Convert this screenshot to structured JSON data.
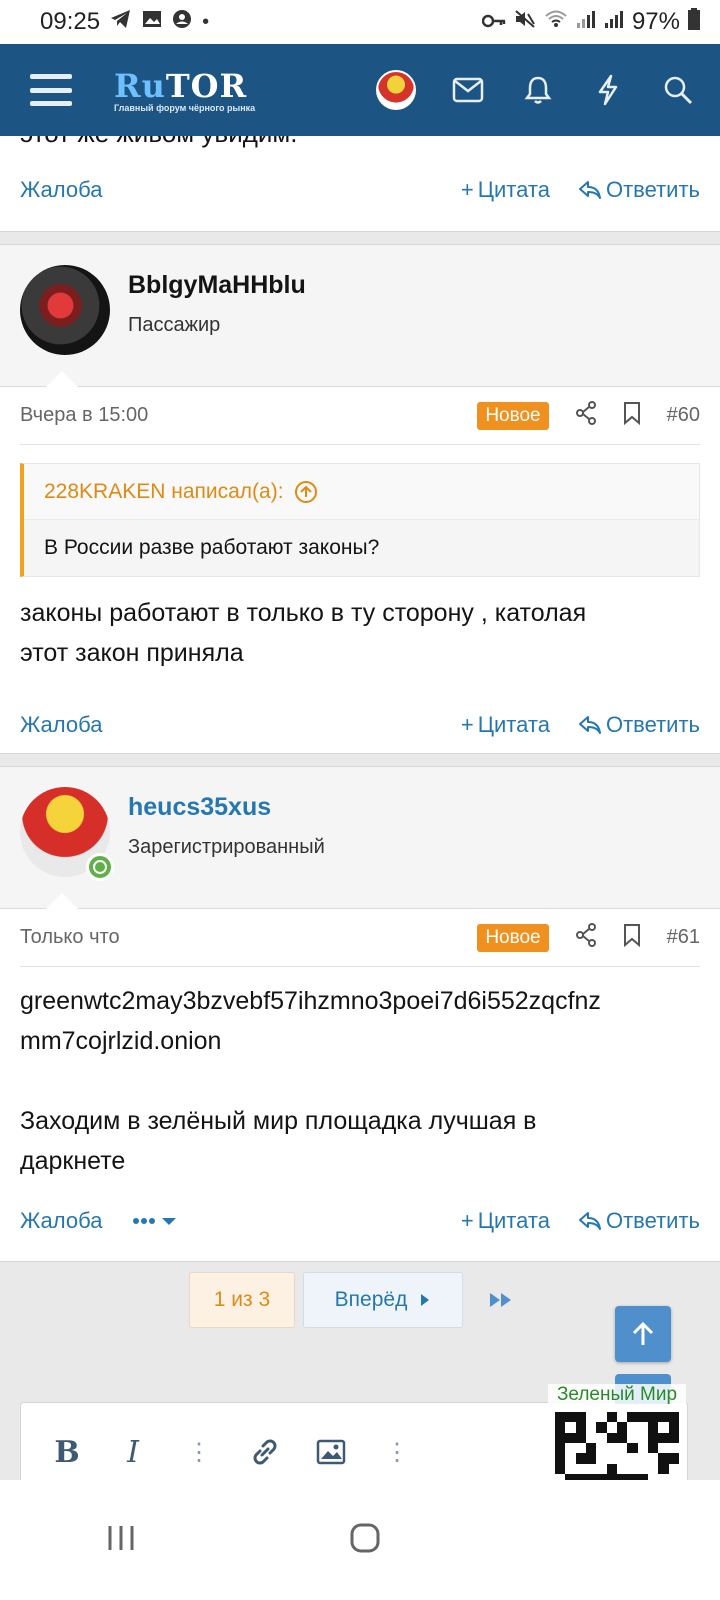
{
  "status_bar": {
    "time": "09:25",
    "battery": "97%"
  },
  "header": {
    "logo_text_a": "Ru",
    "logo_text_b": "TOR",
    "logo_subtitle": "Главный форум чёрного рынка"
  },
  "partial_post": {
    "text": "этот же живом увидим."
  },
  "actions": {
    "report": "Жалоба",
    "quote": "Цитата",
    "reply": "Ответить"
  },
  "posts": [
    {
      "username": "BblgyMaHHblu",
      "user_title": "Пассажир",
      "time": "Вчера в 15:00",
      "badge": "Новое",
      "number": "#60",
      "quote_author": "228KRAKEN написал(а):",
      "quote_text": "В России разве работают законы?",
      "text_lines": [
        "законы работают в только в ту сторону , католая",
        "этот закон приняла"
      ]
    },
    {
      "username": "heucs35xus",
      "user_title": "Зарегистрированный",
      "time": "Только что",
      "badge": "Новое",
      "number": "#61",
      "text_lines": [
        "greenwtc2may3bzvebf57ihzmno3poei7d6i552zqcfnz",
        "mm7cojrlzid.onion",
        "",
        "Заходим в зелёный мир площадка лучшая в",
        "даркнете"
      ]
    }
  ],
  "pager": {
    "current": "1 из 3",
    "next": "Вперёд"
  },
  "ad": {
    "title": "Зеленый Мир"
  },
  "colors": {
    "header": "#1c5584",
    "link": "#2577b1",
    "badge": "#f0901e",
    "quote_border": "#f0a21e"
  }
}
